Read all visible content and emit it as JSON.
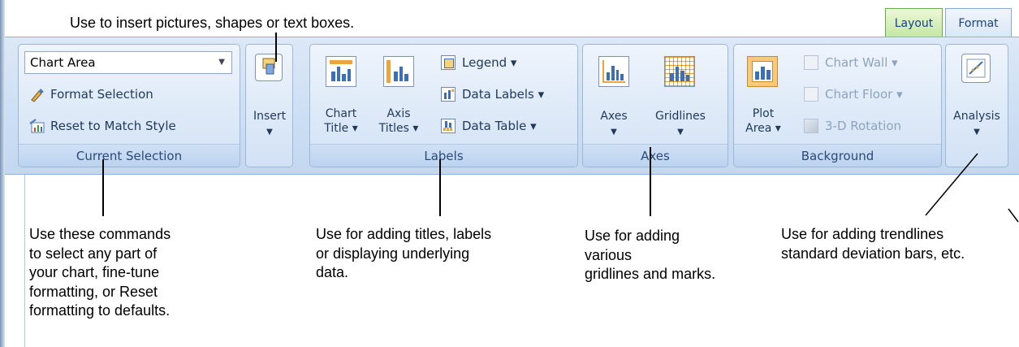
{
  "annotations": {
    "top": "Use to insert pictures, shapes or text boxes.",
    "current_selection": [
      "Use these commands",
      "to select any part of",
      "your chart, fine-tune",
      "formatting, or Reset",
      "formatting to defaults."
    ],
    "labels": [
      "Use for adding titles, labels",
      "or displaying underlying",
      "data."
    ],
    "axes": [
      "Use for adding",
      "various",
      "gridlines and marks."
    ],
    "analysis": [
      "Use for adding trendlines",
      "standard deviation bars, etc."
    ]
  },
  "tabs": [
    {
      "label": "Layout",
      "active": true
    },
    {
      "label": "Format",
      "active": false
    }
  ],
  "groups": {
    "current_selection": {
      "label": "Current Selection",
      "combo_value": "Chart Area",
      "format_selection": "Format Selection",
      "reset_style": "Reset to Match Style"
    },
    "insert": {
      "label": "Insert"
    },
    "labels": {
      "label": "Labels",
      "chart_title": [
        "Chart",
        "Title ▾"
      ],
      "axis_titles": [
        "Axis",
        "Titles ▾"
      ],
      "legend": "Legend ▾",
      "data_labels": "Data Labels ▾",
      "data_table": "Data Table ▾"
    },
    "axes": {
      "label": "Axes",
      "axes_btn": "Axes",
      "gridlines_btn": "Gridlines"
    },
    "background": {
      "label": "Background",
      "plot_area": [
        "Plot",
        "Area ▾"
      ],
      "chart_wall": "Chart Wall ▾",
      "chart_floor": "Chart Floor ▾",
      "rotation": "3-D Rotation"
    },
    "analysis": {
      "label": "Analysis"
    }
  },
  "colors": {
    "ribbon_text": "#1e395b",
    "active_tab": "#c3e7a4",
    "group_border": "#9db7d8"
  },
  "icons": [
    "insert-shapes-icon",
    "format-selection-icon",
    "reset-style-icon",
    "chart-title-icon",
    "axis-titles-icon",
    "legend-icon",
    "data-labels-icon",
    "data-table-icon",
    "axes-icon",
    "gridlines-icon",
    "plot-area-icon",
    "chart-wall-icon",
    "chart-floor-icon",
    "3d-rotation-icon",
    "analysis-icon"
  ]
}
